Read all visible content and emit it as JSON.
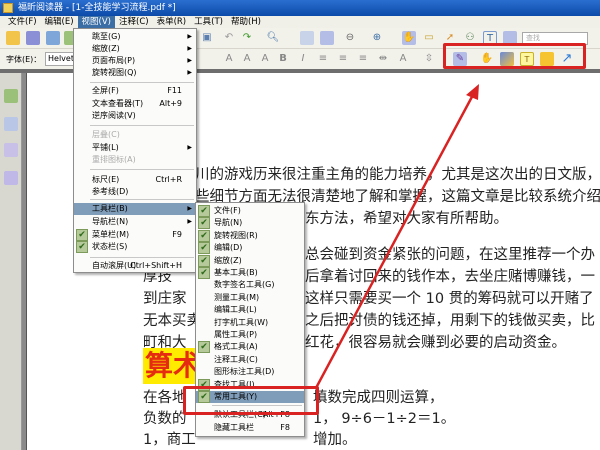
{
  "window": {
    "title": "福昕阅读器 - [1-全技能学习流程.pdf *]"
  },
  "menubar": [
    "文件(F)",
    "编辑(E)",
    "视图(V)",
    "注释(C)",
    "表单(R)",
    "工具(T)",
    "帮助(H)"
  ],
  "toolbar": {
    "font_label": "字体(E)：",
    "font_value": "Helvetica",
    "search_placeholder": "查找"
  },
  "view_menu": [
    {
      "label": "跳至(G)",
      "arrow": true
    },
    {
      "label": "缩放(Z)",
      "arrow": true
    },
    {
      "label": "页面布局(P)",
      "arrow": true
    },
    {
      "label": "旋转视图(Q)",
      "arrow": true
    },
    {
      "label": "全屏(F)",
      "shortcut": "F11"
    },
    {
      "label": "文本查看器(T)",
      "shortcut": "Alt+9"
    },
    {
      "label": "逆序阅读(V)"
    },
    {
      "label": "层叠(C)",
      "disabled": true
    },
    {
      "label": "平铺(L)",
      "arrow": true
    },
    {
      "label": "重排图标(A)",
      "disabled": true
    },
    {
      "label": "标尺(E)",
      "shortcut": "Ctrl+R"
    },
    {
      "label": "参考线(D)"
    },
    {
      "label": "工具栏(B)",
      "arrow": true
    },
    {
      "label": "导航栏(N)",
      "arrow": true
    },
    {
      "label": "菜单栏(M)",
      "shortcut": "F9",
      "checked": true
    },
    {
      "label": "状态栏(S)",
      "checked": true
    },
    {
      "label": "自动滚屏(U)",
      "shortcut": "Ctrl+Shift+H"
    }
  ],
  "toolbar_submenu": [
    {
      "label": "文件(F)",
      "checked": true
    },
    {
      "label": "导航(N)",
      "checked": true
    },
    {
      "label": "旋转视图(R)",
      "checked": true
    },
    {
      "label": "编辑(D)",
      "checked": true
    },
    {
      "label": "缩放(Z)",
      "checked": true
    },
    {
      "label": "基本工具(B)",
      "checked": true
    },
    {
      "label": "数字签名工具(G)"
    },
    {
      "label": "测量工具(M)"
    },
    {
      "label": "编辑工具(L)"
    },
    {
      "label": "打字机工具(W)"
    },
    {
      "label": "属性工具(P)"
    },
    {
      "label": "格式工具(A)",
      "checked": true
    },
    {
      "label": "注释工具(C)"
    },
    {
      "label": "图形标注工具(D)"
    },
    {
      "label": "查找工具(I)",
      "checked": true
    },
    {
      "label": "常用工具(Y)",
      "checked": true
    },
    {
      "label": "默认工具栏(C)",
      "shortcut": "Alt+F8"
    },
    {
      "label": "隐藏工具栏",
      "shortcut": "F8"
    }
  ],
  "document": {
    "lines": [
      {
        "right": "川的游戏历来很注重主角的能力培养，尤其是这次出的日文版，"
      },
      {
        "right": "些细节方面无法很清楚地了解和掌握，这篇文章是比较系统介绍"
      },
      {
        "right": "东方法，希望对大家有所帮助。"
      },
      {
        "right": "总会碰到资金紧张的问题，在这里推荐一个办"
      },
      {
        "left": "厚技",
        "right": "后拿着讨回来的钱作本，去坐庄赌博赚钱，一"
      },
      {
        "left": "到庄家",
        "right": "这样只需要买一个 10 贯的筹码就可以开赌了"
      },
      {
        "left": "无本买卖",
        "right": "之后把讨债的钱还掉，用剩下的钱做买卖，比"
      },
      {
        "left": "町和大",
        "right": "红花，很容易就会赚到必要的启动资金。"
      },
      {
        "left": "在各地",
        "right": "填数完成四则运算，"
      },
      {
        "left": "负数的",
        "right": "1， 9÷6－1÷2＝1。"
      },
      {
        "left": "1，商工",
        "right": "增加。"
      }
    ],
    "heading": "算术"
  },
  "colors": {
    "annotation": "#d92222",
    "highlight": "#ffeb00",
    "heading_text": "#e52b10"
  }
}
